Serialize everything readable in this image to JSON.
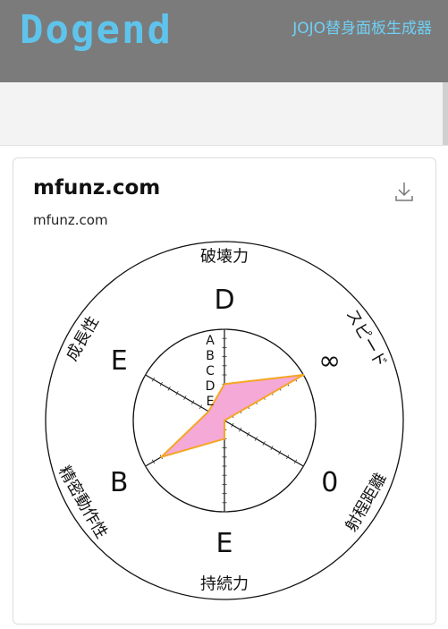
{
  "header": {
    "logo_text": "Dogend",
    "nav_link": "JOJO替身面板生成器"
  },
  "card": {
    "title": "mfunz.com",
    "subtitle": "mfunz.com",
    "download_icon": "download-icon"
  },
  "chart_data": {
    "type": "radar",
    "scale_labels": [
      "A",
      "B",
      "C",
      "D",
      "E"
    ],
    "axes": [
      {
        "name": "破壊力",
        "grade": "D",
        "value": 0.4
      },
      {
        "name": "スピード",
        "grade": "∞",
        "value": 1.0
      },
      {
        "name": "射程距離",
        "grade": "0",
        "value": 0.0
      },
      {
        "name": "持続力",
        "grade": "E",
        "value": 0.2
      },
      {
        "name": "精密動作性",
        "grade": "B",
        "value": 0.8
      },
      {
        "name": "成長性",
        "grade": "E",
        "value": 0.2
      }
    ],
    "fill_color": "#f4a9d6",
    "stroke_color": "#f5a623"
  }
}
